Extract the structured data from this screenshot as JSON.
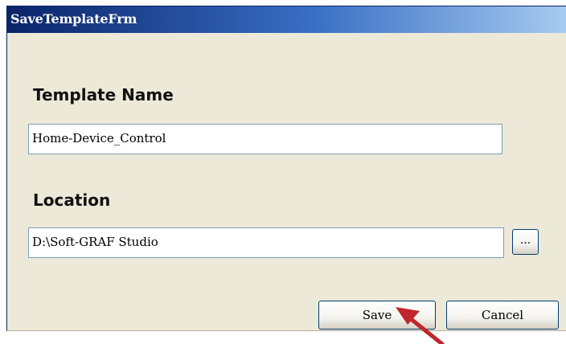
{
  "window": {
    "title": "SaveTemplateFrm"
  },
  "form": {
    "template_name_label": "Template Name",
    "template_name_value": "Home-Device_Control",
    "location_label": "Location",
    "location_value": "D:\\Soft-GRAF Studio",
    "browse_label": "..."
  },
  "buttons": {
    "save_label": "Save",
    "cancel_label": "Cancel"
  },
  "colors": {
    "window_bg": "#ece9d8",
    "titlebar_start": "#0a246a",
    "titlebar_end": "#a6caf0",
    "annotation_arrow": "#c0262c"
  }
}
